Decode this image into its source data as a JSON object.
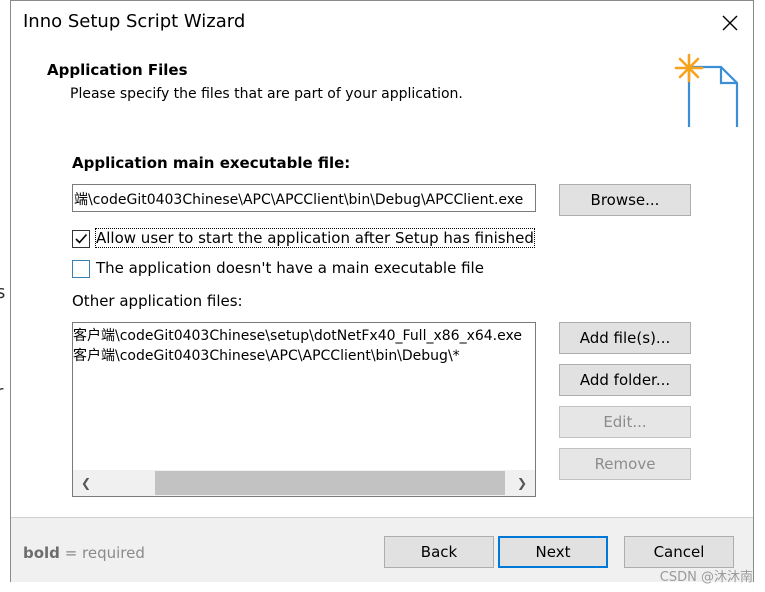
{
  "window": {
    "title": "Inno Setup Script Wizard"
  },
  "header": {
    "heading": "Application Files",
    "subtitle": "Please specify the files that are part of your application."
  },
  "main_exe": {
    "label": "Application main executable file:",
    "value": "端\\codeGit0403Chinese\\APC\\APCClient\\bin\\Debug\\APCClient.exe",
    "browse_label": "Browse..."
  },
  "options": {
    "allow_start": {
      "label": "Allow user to start the application after Setup has finished",
      "checked": true
    },
    "no_main_exe": {
      "label": "The application doesn't have a main executable file",
      "checked": false
    }
  },
  "other_files": {
    "label": "Other application files:",
    "items": [
      "客户端\\codeGit0403Chinese\\setup\\dotNetFx40_Full_x86_x64.exe",
      "客户端\\codeGit0403Chinese\\APC\\APCClient\\bin\\Debug\\*"
    ],
    "buttons": {
      "add_files": "Add file(s)...",
      "add_folder": "Add folder...",
      "edit": "Edit...",
      "remove": "Remove"
    }
  },
  "footer": {
    "hint_bold": "bold",
    "hint_rest": " = required",
    "back": "Back",
    "next": "Next",
    "cancel": "Cancel"
  },
  "watermark": "CSDN @沐沐南",
  "background_glyphs": [
    "s",
    "r"
  ],
  "colors": {
    "focus_border": "#0078d7",
    "icon_star": "#f7a21b",
    "icon_doc": "#3a8fd6"
  }
}
